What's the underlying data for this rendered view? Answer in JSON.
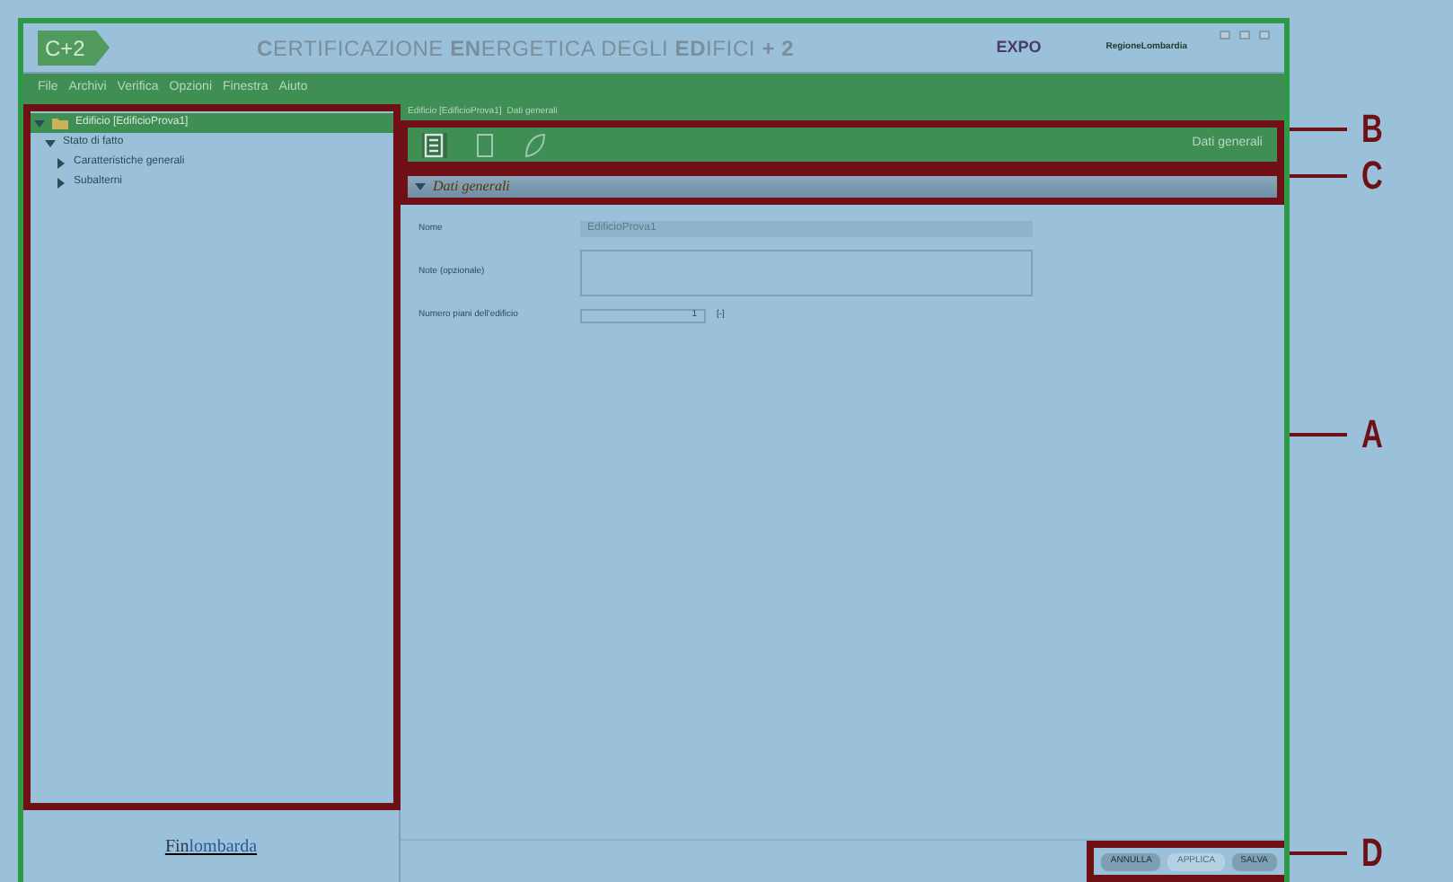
{
  "window": {
    "logo": "C+2",
    "title": "**C**ERTIFICAZIONE **EN**ERGETICA DEGLI **ED**IFICI **+ 2**",
    "partner_1": "EXPO",
    "partner_2": "RegioneLombardia"
  },
  "menu": [
    "File",
    "Archivi",
    "Verifica",
    "Opzioni",
    "Finestra",
    "Aiuto"
  ],
  "tree": [
    {
      "label": "Edificio [EdificioProva1]",
      "expanded": true,
      "selected": true,
      "children": [
        {
          "label": "Stato di fatto",
          "expanded": true,
          "selected": false,
          "children": [
            {
              "label": "Caratteristiche generali",
              "expanded": false,
              "selected": false
            },
            {
              "label": "Subalterni",
              "expanded": false,
              "selected": false
            }
          ]
        }
      ]
    }
  ],
  "footer_logo": {
    "part_1": "Fin",
    "part_2": "lombarda"
  },
  "breadcrumb": [
    "Edificio [EdificioProva1]",
    "Dati generali"
  ],
  "toolbar": {
    "tools": [
      {
        "kind": "book",
        "selected": true
      },
      {
        "kind": "page",
        "selected": false
      },
      {
        "kind": "leaf",
        "selected": false
      }
    ],
    "title": "Dati generali"
  },
  "section": {
    "title": "Dati generali",
    "expanded": true
  },
  "form": [
    {
      "kind": "text",
      "label": "Nome",
      "value": "EdificioProva1"
    },
    {
      "kind": "textarea",
      "label": "Note (opzionale)"
    },
    {
      "kind": "spinner",
      "label": "Numero piani dell'edificio",
      "value": "1",
      "unit": "[-]"
    }
  ],
  "buttons": [
    {
      "label": "ANNULLA",
      "disabled": false
    },
    {
      "label": "APPLICA",
      "disabled": true
    },
    {
      "label": "SALVA",
      "disabled": false
    }
  ],
  "annotations": [
    {
      "letter": "B",
      "kind": "toolbar"
    },
    {
      "letter": "C",
      "kind": "section"
    },
    {
      "letter": "A",
      "kind": "tree"
    },
    {
      "letter": "D",
      "kind": "buttons"
    }
  ]
}
